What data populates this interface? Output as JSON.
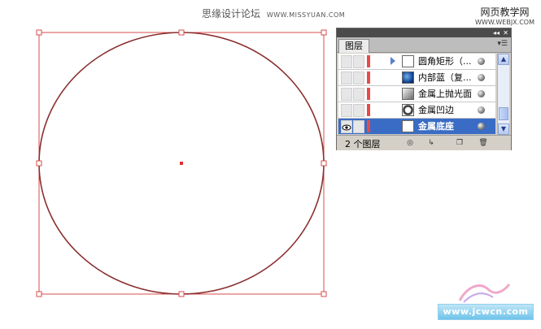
{
  "header": {
    "title": "思缘设计论坛",
    "url": "WWW.MISSYUAN.COM"
  },
  "watermark": {
    "corner_line1": "网页教学网",
    "corner_line2": "WWW.WEBJX.COM",
    "bottom": "www.jcwcn.com"
  },
  "canvas": {
    "shape": "ellipse",
    "stroke_color": "#8b2f2f",
    "selection_color": "#d94c4c"
  },
  "layers_panel": {
    "titlebar": {
      "collapse": "◂◂",
      "close": "✕"
    },
    "tab_label": "图层",
    "menu_icon": "panel-menu-icon",
    "layers": [
      {
        "name": "圆角矩形（...",
        "has_expander": true,
        "visible": false,
        "selected": false,
        "thumb": "rounded-rect-thumb-icon"
      },
      {
        "name": "内部蓝（复...",
        "has_expander": false,
        "visible": false,
        "selected": false,
        "thumb": "blue-circle-thumb-icon"
      },
      {
        "name": "金属上抛光面",
        "has_expander": false,
        "visible": false,
        "selected": false,
        "thumb": "gradient-thumb-icon"
      },
      {
        "name": "金属凹边",
        "has_expander": false,
        "visible": false,
        "selected": false,
        "thumb": "ring-thumb-icon"
      },
      {
        "name": "金属底座",
        "has_expander": false,
        "visible": true,
        "selected": true,
        "thumb": "white-thumb-icon"
      }
    ],
    "footer": {
      "count_label": "2 个图层",
      "buttons": [
        "make-clip-mask-icon",
        "new-sublayer-icon",
        "new-layer-icon",
        "trash-icon"
      ]
    },
    "colors": {
      "accent": "#3a6cc5",
      "layer_color": "#e84a4a"
    }
  }
}
